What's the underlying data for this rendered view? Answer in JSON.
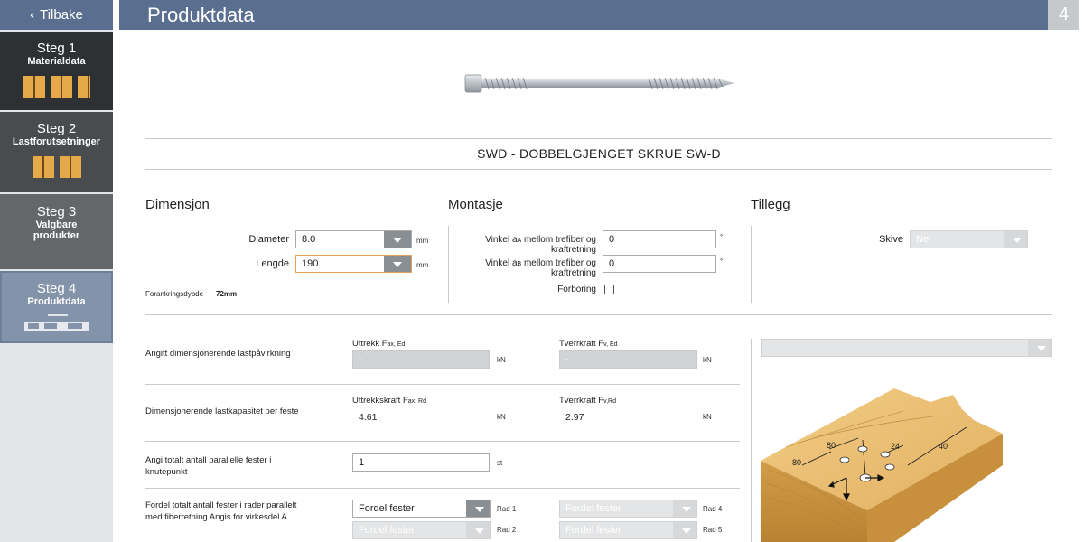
{
  "sidebar": {
    "back_label": "Tilbake",
    "steps": [
      {
        "num": "Steg 1",
        "sub": "Materialdata"
      },
      {
        "num": "Steg 2",
        "sub": "Lastforutsetninger"
      },
      {
        "num": "Steg 3",
        "sub": "Valgbare produkter"
      },
      {
        "num": "Steg 4",
        "sub": "Produktdata"
      }
    ]
  },
  "header": {
    "title": "Produktdata",
    "step_number": "4"
  },
  "product": {
    "title": "SWD - DOBBELGJENGET SKRUE SW-D"
  },
  "dimensjon": {
    "heading": "Dimensjon",
    "diameter_label": "Diameter",
    "diameter_value": "8.0",
    "diameter_unit": "mm",
    "lengde_label": "Lengde",
    "lengde_value": "190",
    "lengde_unit": "mm",
    "forankring_label": "Forankringsdybde",
    "forankring_value": "72mm"
  },
  "montasje": {
    "heading": "Montasje",
    "vinkel_a_label_1": "Vinkel a",
    "vinkel_a_sub": "A",
    "vinkel_a_label_2": " mellom trefiber og",
    "vinkel_a_label_3": "kraftretning",
    "vinkel_a_value": "0",
    "vinkel_a_unit": "°",
    "vinkel_b_label_1": "Vinkel a",
    "vinkel_b_sub": "B",
    "vinkel_b_label_2": " mellom trefiber og",
    "vinkel_b_label_3": "kraftretning",
    "vinkel_b_value": "0",
    "vinkel_b_unit": "°",
    "forboring_label": "Forboring"
  },
  "tillegg": {
    "heading": "Tillegg",
    "skive_label": "Skive",
    "skive_value": "Nei"
  },
  "load": {
    "row1_label": "Angitt dimensjonerende lastpåvirkning",
    "uttrekk_label": "Uttrekk F",
    "uttrekk_sub": "ax, Ed",
    "uttrekk_value": "-",
    "uttrekk_unit": "kN",
    "tverr_label": "Tverrkraft F",
    "tverr_sub": "v, Ed",
    "tverr_value": "-",
    "tverr_unit": "kN",
    "row2_label": "Dimensjonerende lastkapasitet per feste",
    "uttrekkskraft_label": "Uttrekkskraft F",
    "uttrekkskraft_sub": "ax, Rd",
    "uttrekkskraft_value": "4.61",
    "uttrekkskraft_unit": "kN",
    "tverr2_label": "Tverrkraft F",
    "tverr2_sub": "v,Rd",
    "tverr2_value": "2.97",
    "tverr2_unit": "kN",
    "row3_label_1": "Angi totalt antall parallelle fester i",
    "row3_label_2": "knutepunkt",
    "antall_value": "1",
    "antall_unit": "st",
    "row4_label_1": "Fordel totalt antall fester i rader parallelt",
    "row4_label_2": "med fiberretning Angis for virkesdel A",
    "fordel_value": "Fordel fester",
    "rad1": "Rad 1",
    "rad2": "Rad 2",
    "rad4": "Rad 4",
    "rad5": "Rad 5"
  },
  "diagram": {
    "dim_80a": "80",
    "dim_80b": "80",
    "dim_24": "24",
    "dim_40": "40"
  }
}
